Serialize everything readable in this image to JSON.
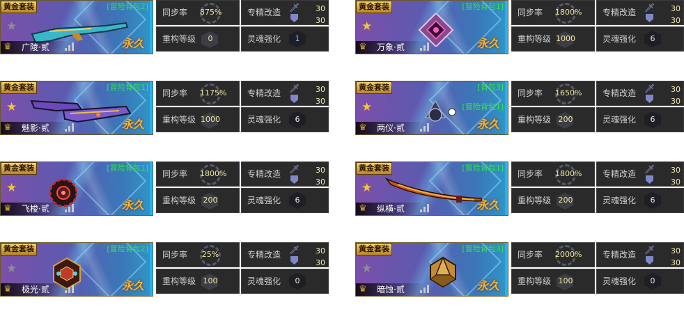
{
  "labels": {
    "sync": "同步率",
    "rebuild": "重构等级",
    "exclusive": "专精改造",
    "soul": "灵魂强化"
  },
  "cards": [
    {
      "set": "黄金套装",
      "bag": "[冒险背包2]",
      "bag2": "",
      "star": "grey",
      "name": "广陵·贰",
      "perm": "永久",
      "sync": "875%",
      "rebuild": "0",
      "p1": "30",
      "p2": "30",
      "soul": "1",
      "soul_color": "blue",
      "weapon": "rifle"
    },
    {
      "set": "黄金套装",
      "bag": "[冒险背包1]",
      "bag2": "",
      "star": "gold",
      "name": "万象·贰",
      "perm": "永久",
      "sync": "1800%",
      "rebuild": "1000",
      "p1": "30",
      "p2": "30",
      "soul": "6",
      "soul_color": "white",
      "weapon": "diamond"
    },
    {
      "set": "黄金套装",
      "bag": "[冒险背包1]",
      "bag2": "",
      "star": "gold",
      "name": "魅影·贰",
      "perm": "永久",
      "sync": "1175%",
      "rebuild": "1000",
      "p1": "30",
      "p2": "30",
      "soul": "6",
      "soul_color": "white",
      "weapon": "dual"
    },
    {
      "set": "黄金套装",
      "bag": "[背包3]",
      "bag2": "[冒险背包1]",
      "star": "gold",
      "name": "两仪·贰",
      "perm": "永久",
      "sync": "1650%",
      "rebuild": "200",
      "p1": "30",
      "p2": "30",
      "soul": "6",
      "soul_color": "white",
      "weapon": "orb"
    },
    {
      "set": "黄金套装",
      "bag": "[冒险背包1]",
      "bag2": "",
      "star": "gold",
      "name": "飞梭·贰",
      "perm": "永久",
      "sync": "1800%",
      "rebuild": "200",
      "p1": "30",
      "p2": "30",
      "soul": "6",
      "soul_color": "white",
      "weapon": "disc"
    },
    {
      "set": "黄金套装",
      "bag": "[冒险背包1]",
      "bag2": "",
      "star": "gold",
      "name": "纵横·贰",
      "perm": "永久",
      "sync": "1800%",
      "rebuild": "200",
      "p1": "30",
      "p2": "30",
      "soul": "6",
      "soul_color": "white",
      "weapon": "blade"
    },
    {
      "set": "黄金套装",
      "bag": "[冒险背包2]",
      "bag2": "",
      "star": "grey",
      "name": "极光·贰",
      "perm": "永久",
      "sync": "25%",
      "rebuild": "100",
      "p1": "30",
      "p2": "30",
      "soul": "0",
      "soul_color": "white",
      "weapon": "cube"
    },
    {
      "set": "黄金套装",
      "bag": "[冒险背包3]",
      "bag2": "",
      "star": "grey",
      "name": "暗蚀·贰",
      "perm": "永久",
      "sync": "2000%",
      "rebuild": "100",
      "p1": "30",
      "p2": "30",
      "soul": "0",
      "soul_color": "white",
      "weapon": "d20"
    }
  ]
}
